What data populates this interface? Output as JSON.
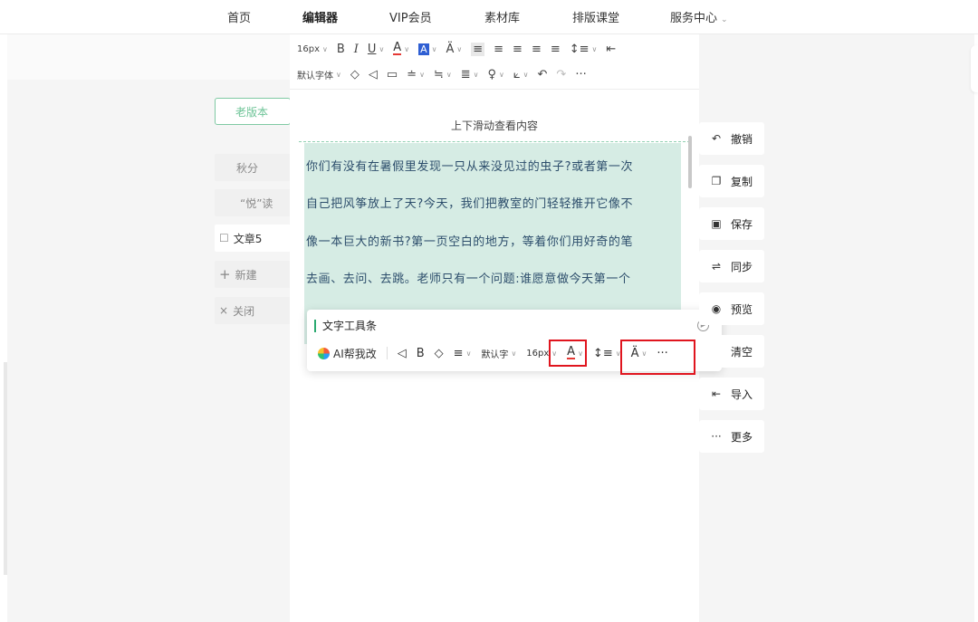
{
  "nav": {
    "items": [
      "首页",
      "编辑器",
      "VIP会员",
      "素材库",
      "排版课堂",
      "服务中心"
    ],
    "active_index": 1
  },
  "sidebar": {
    "old_version_label": "老版本",
    "items": [
      {
        "label": "秋分",
        "icon": ""
      },
      {
        "label": "“悦”读",
        "icon": ""
      },
      {
        "label": "文章5",
        "icon": "edit-icon"
      },
      {
        "label": "新建",
        "icon": "plus-icon"
      },
      {
        "label": "关闭",
        "icon": "close-icon"
      }
    ]
  },
  "toolbar": {
    "font_size": "16px",
    "font_family": "默认字体"
  },
  "editor": {
    "scroll_hint": "上下滑动查看内容",
    "paragraph_lines": [
      "你们有没有在暑假里发现一只从来没见过的虫子?或者第一次",
      "自己把风筝放上了天?今天，我们把教室的门轻轻推开它像不",
      "像一本巨大的新书?第一页空白的地方，等着你们用好奇的笔",
      "去画、去问、去跳。老师只有一个问题:谁愿意做今天第一个"
    ]
  },
  "text_toolbar": {
    "title": "文字工具条",
    "ai_label": "AI帮我改",
    "font_family": "默认字",
    "font_size": "16px"
  },
  "actions": [
    "撤销",
    "复制",
    "保存",
    "同步",
    "预览",
    "清空",
    "导入",
    "更多"
  ],
  "colors": {
    "accent_green": "#2aa970",
    "content_bg": "#d6ece4",
    "content_text": "#2c4d6b",
    "highlight_red": "#e0151e"
  }
}
